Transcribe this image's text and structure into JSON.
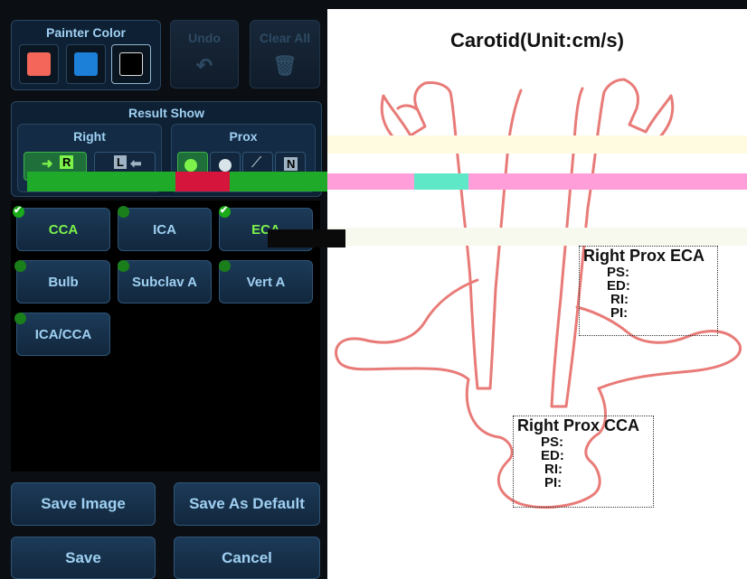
{
  "painter": {
    "title": "Painter Color",
    "colors": [
      "#f4665a",
      "#1c7fd8",
      "#000000"
    ],
    "undo_label": "Undo",
    "clear_all_label": "Clear All"
  },
  "result_show": {
    "title": "Result Show",
    "side_label": "Right",
    "position_label": "Prox",
    "right_button": "R",
    "left_button": "L",
    "n_button": "N"
  },
  "vessels": [
    {
      "label": "CCA",
      "checked": true,
      "selected": true
    },
    {
      "label": "ICA",
      "checked": false,
      "selected": false
    },
    {
      "label": "ECA",
      "checked": true,
      "selected": true
    },
    {
      "label": "Bulb",
      "checked": false,
      "selected": false
    },
    {
      "label": "Subclav A",
      "checked": false,
      "selected": false
    },
    {
      "label": "Vert A",
      "checked": false,
      "selected": false
    },
    {
      "label": "ICA/CCA",
      "checked": false,
      "selected": false
    }
  ],
  "actions": {
    "save_image": "Save Image",
    "save_default": "Save As Default",
    "save": "Save",
    "cancel": "Cancel"
  },
  "diagram": {
    "title": "Carotid(Unit:cm/s)",
    "eca_box": {
      "title": "Right Prox ECA",
      "lines": [
        "PS:",
        "ED:",
        "RI:",
        "PI:"
      ]
    },
    "cca_box": {
      "title": "Right Prox CCA",
      "lines": [
        "PS:",
        "ED:",
        "RI:",
        "PI:"
      ]
    },
    "outline_color": "#e87b78"
  }
}
